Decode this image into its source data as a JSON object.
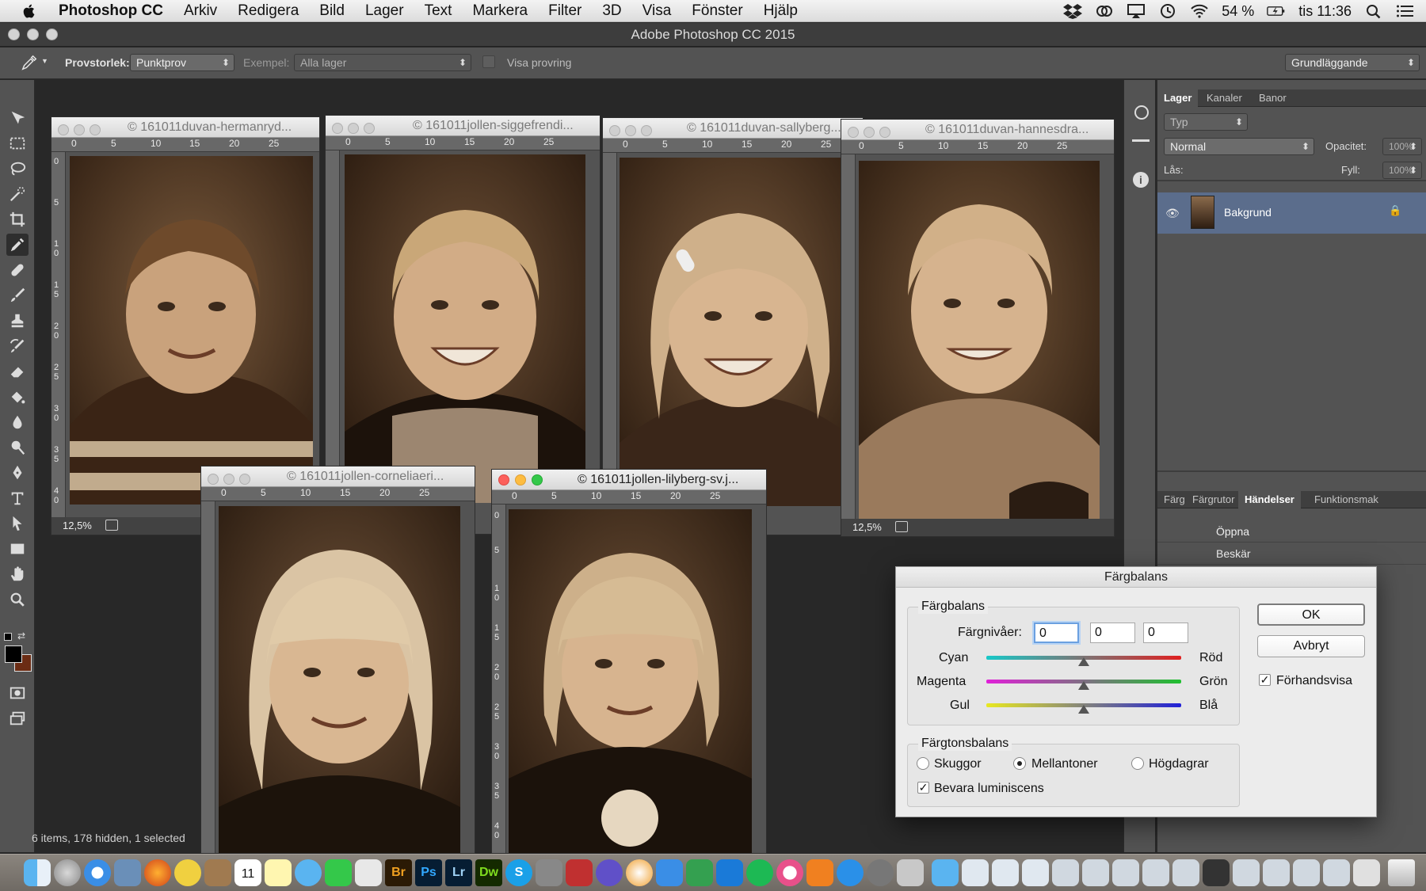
{
  "menubar": {
    "app_name": "Photoshop CC",
    "items": [
      "Arkiv",
      "Redigera",
      "Bild",
      "Lager",
      "Text",
      "Markera",
      "Filter",
      "3D",
      "Visa",
      "Fönster",
      "Hjälp"
    ],
    "battery": "54 %",
    "clock": "tis 11:36"
  },
  "window": {
    "title": "Adobe Photoshop CC 2015"
  },
  "options": {
    "sample_size_label": "Provstorlek:",
    "sample_size_value": "Punktprov",
    "sample_label": "Exempel:",
    "sample_value": "Alla lager",
    "show_ring_label": "Visa provring",
    "workspace": "Grundläggande"
  },
  "ruler": {
    "h_ticks": [
      "0",
      "5",
      "10",
      "15",
      "20",
      "25"
    ],
    "v_ticks": [
      "0",
      "5",
      "1 0",
      "1 5",
      "2 0",
      "2 5",
      "3 0",
      "3 5",
      "4 0"
    ]
  },
  "documents": [
    {
      "title": "© 161011duvan-hermanryd...",
      "zoom": "12,5%"
    },
    {
      "title": "© 161011jollen-siggefrendi..."
    },
    {
      "title": "© 161011duvan-sallyberg..."
    },
    {
      "title": "© 161011duvan-hannesdra...",
      "zoom": "12,5%"
    },
    {
      "title": "© 161011jollen-corneliaeri..."
    },
    {
      "title": "© 161011jollen-lilyberg-sv.j..."
    }
  ],
  "finder_status": "6 items, 178 hidden, 1 selected",
  "layers_panel": {
    "tabs": [
      "Lager",
      "Kanaler",
      "Banor"
    ],
    "filter": "Typ",
    "blend_mode": "Normal",
    "opacity_label": "Opacitet:",
    "opacity_value": "100%",
    "lock_label": "Lås:",
    "fill_label": "Fyll:",
    "fill_value": "100%",
    "layer_name": "Bakgrund"
  },
  "actions_panel": {
    "tabs": [
      "Färg",
      "Färgrutor",
      "Händelser",
      "Funktionsmak"
    ],
    "items": [
      "Öppna",
      "Beskär"
    ]
  },
  "dialog": {
    "title": "Färgbalans",
    "group1_label": "Färgbalans",
    "levels_label": "Färgnivåer:",
    "levels": [
      "0",
      "0",
      "0"
    ],
    "sliders": [
      {
        "left": "Cyan",
        "right": "Röd",
        "value": 0
      },
      {
        "left": "Magenta",
        "right": "Grön",
        "value": 0
      },
      {
        "left": "Gul",
        "right": "Blå",
        "value": 0
      }
    ],
    "group2_label": "Färgtonsbalans",
    "tones": [
      "Skuggor",
      "Mellantoner",
      "Högdagrar"
    ],
    "selected_tone": "Mellantoner",
    "preserve_label": "Bevara luminiscens",
    "preserve_checked": true,
    "ok": "OK",
    "cancel": "Avbryt",
    "preview_label": "Förhandsvisa",
    "preview_checked": true
  },
  "dock": {
    "calendar_day": "11"
  }
}
